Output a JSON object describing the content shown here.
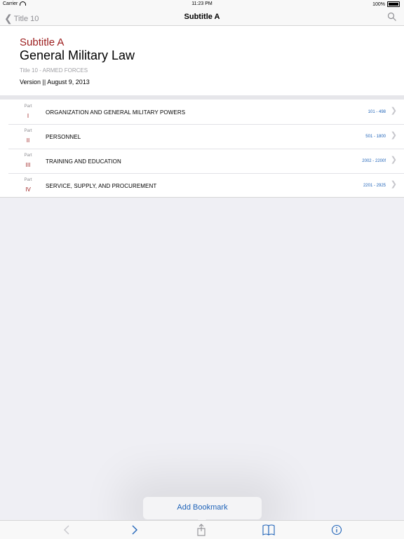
{
  "status_bar": {
    "carrier": "Carrier",
    "time": "11:23 PM",
    "battery": "100%"
  },
  "navbar": {
    "back_label": "Title 10",
    "title": "Subtitle A",
    "search_icon": "search-icon"
  },
  "header": {
    "subtitle": "Subtitle A",
    "title": "General Military Law",
    "meta": "Title 10 - ARMED FORCES",
    "version": "Version || August 9, 2013"
  },
  "parts": [
    {
      "label": "Part",
      "number": "I",
      "name": "ORGANIZATION AND GENERAL MILITARY POWERS",
      "range": "101 - 498"
    },
    {
      "label": "Part",
      "number": "II",
      "name": "PERSONNEL",
      "range": "501 - 1800"
    },
    {
      "label": "Part",
      "number": "III",
      "name": "TRAINING AND EDUCATION",
      "range": "2002 - 2200f"
    },
    {
      "label": "Part",
      "number": "IV",
      "name": "SERVICE, SUPPLY, AND PROCUREMENT",
      "range": "2201 - 2925"
    }
  ],
  "popup": {
    "label": "Add Bookmark"
  },
  "toolbar": {
    "icons": [
      "back-arrow-icon",
      "forward-arrow-icon",
      "share-icon",
      "bookmarks-book-icon",
      "info-icon"
    ]
  },
  "colors": {
    "accent_red": "#9b1c1c",
    "link_blue": "#1f63b8"
  }
}
